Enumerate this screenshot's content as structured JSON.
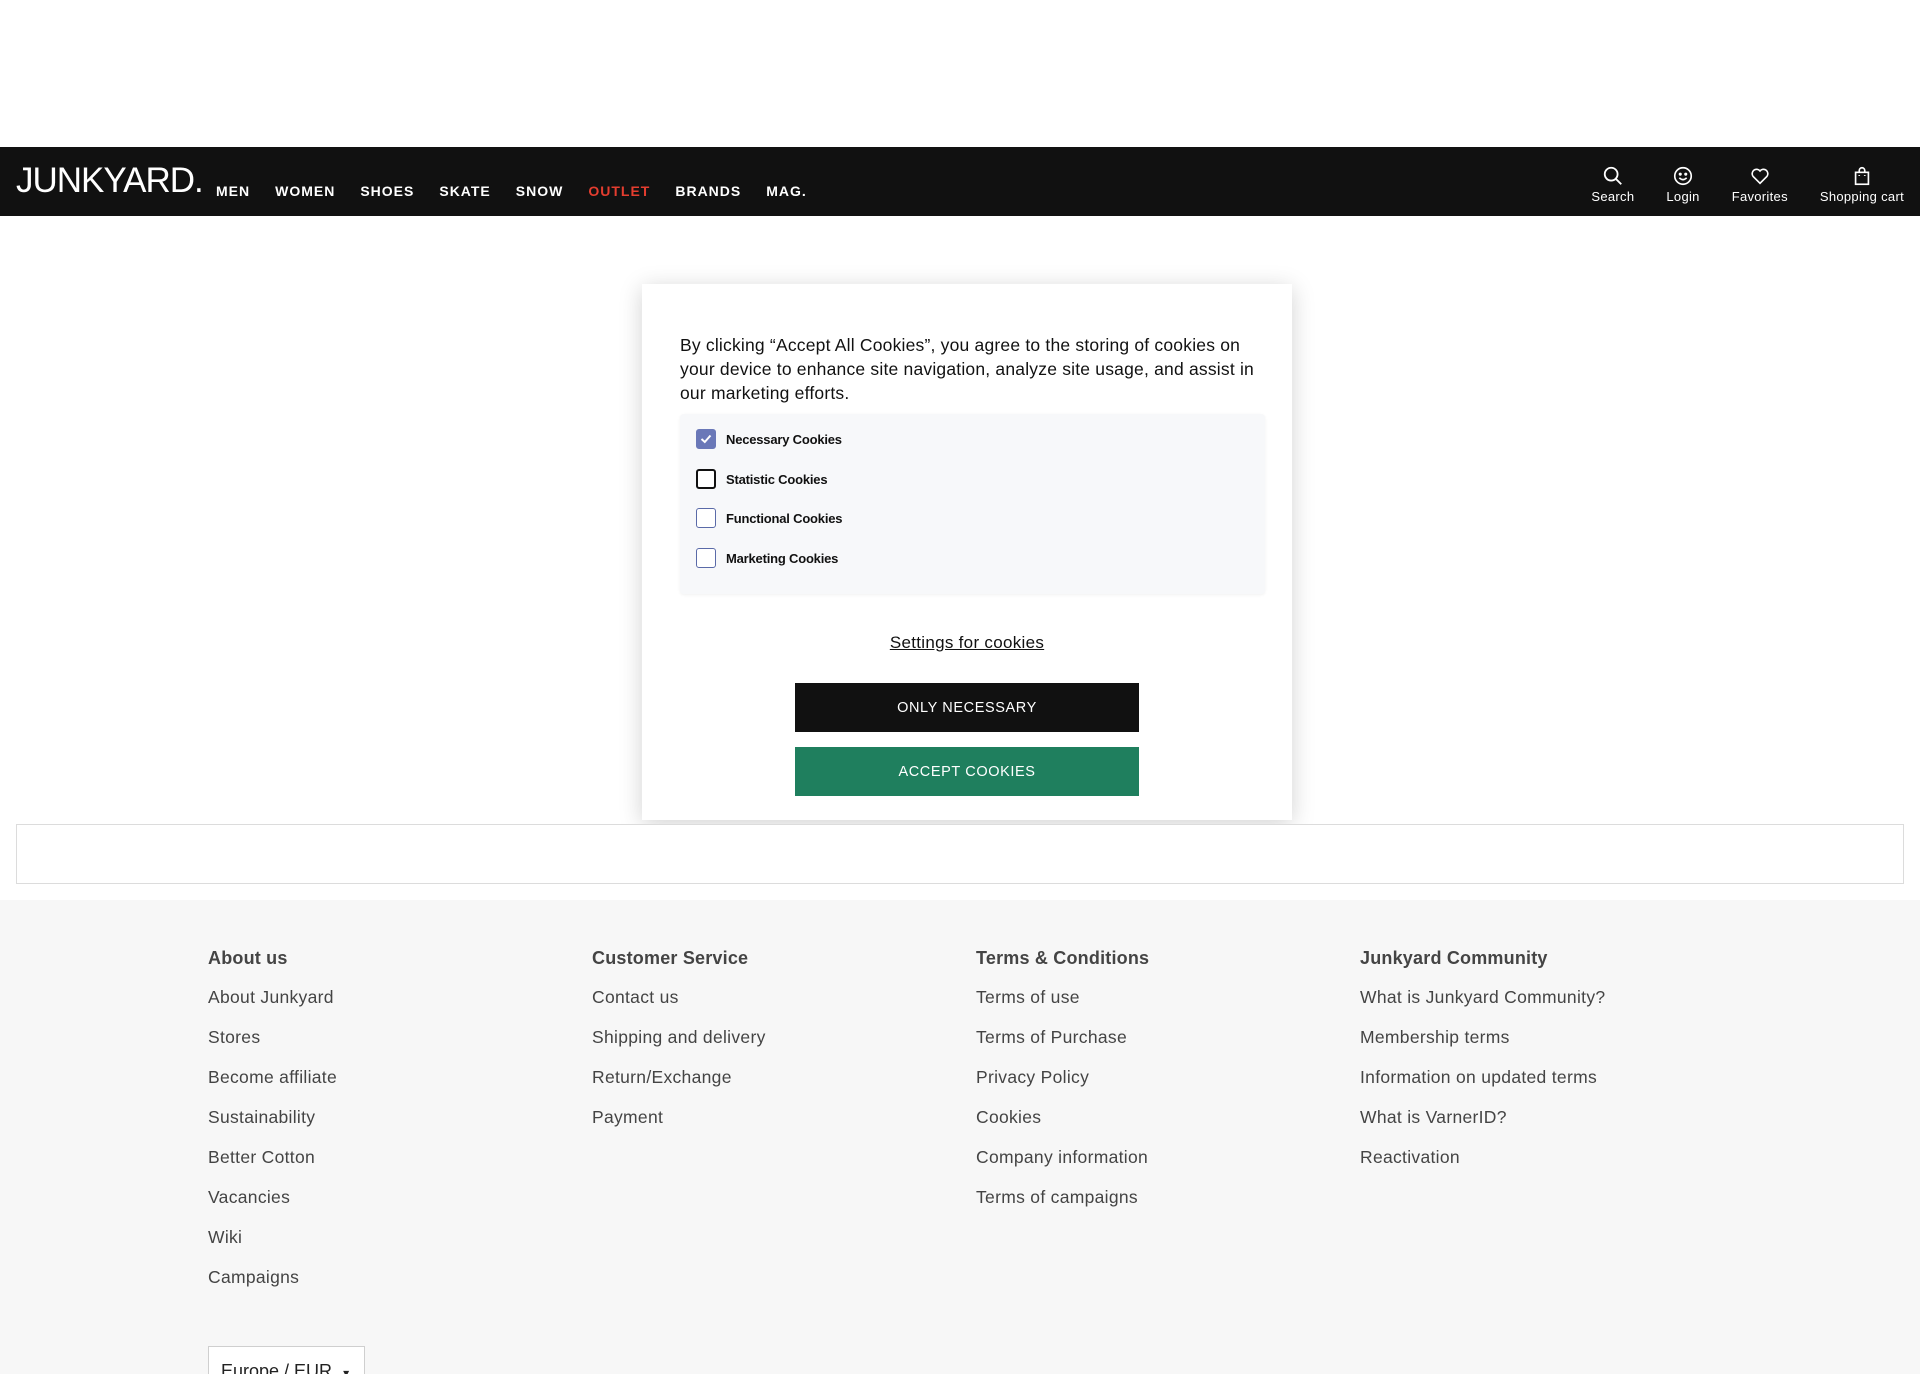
{
  "header": {
    "logo": "JUNKYARD.",
    "nav": [
      {
        "label": "MEN"
      },
      {
        "label": "WOMEN"
      },
      {
        "label": "SHOES"
      },
      {
        "label": "SKATE"
      },
      {
        "label": "SNOW"
      },
      {
        "label": "OUTLET"
      },
      {
        "label": "BRANDS"
      },
      {
        "label": "MAG."
      }
    ],
    "tools": [
      {
        "label": "Search",
        "icon": "search-icon"
      },
      {
        "label": "Login",
        "icon": "smiley-icon"
      },
      {
        "label": "Favorites",
        "icon": "heart-icon"
      },
      {
        "label": "Shopping cart",
        "icon": "bag-icon"
      }
    ]
  },
  "cookie_modal": {
    "text": "By clicking “Accept All Cookies”, you agree to the storing of cookies on your device to enhance site navigation, analyze site usage, and assist in our marketing efforts.",
    "options": [
      {
        "label": "Necessary Cookies",
        "checked": true
      },
      {
        "label": "Statistic Cookies",
        "checked": false
      },
      {
        "label": "Functional Cookies",
        "checked": false
      },
      {
        "label": "Marketing Cookies",
        "checked": false
      }
    ],
    "settings_link": "Settings for cookies",
    "only_necessary": "ONLY NECESSARY",
    "accept": "ACCEPT COOKIES"
  },
  "footer": {
    "columns": [
      {
        "title": "About us",
        "links": [
          "About Junkyard",
          "Stores",
          "Become affiliate",
          "Sustainability",
          "Better Cotton",
          "Vacancies",
          "Wiki",
          "Campaigns"
        ]
      },
      {
        "title": "Customer Service",
        "links": [
          "Contact us",
          "Shipping and delivery",
          "Return/Exchange",
          "Payment"
        ]
      },
      {
        "title": "Terms & Conditions",
        "links": [
          "Terms of use",
          "Terms of Purchase",
          "Privacy Policy",
          "Cookies",
          "Company information",
          "Terms of campaigns"
        ]
      },
      {
        "title": "Junkyard Community",
        "links": [
          "What is Junkyard Community?",
          "Membership terms",
          "Information on updated terms",
          "What is VarnerID?",
          "Reactivation"
        ]
      }
    ],
    "region": "Europe / EUR"
  },
  "colors": {
    "header_bg": "#111111",
    "outlet": "#e43d2f",
    "accept_button": "#1f7f5e",
    "checkbox_checked": "#6a78b8"
  }
}
